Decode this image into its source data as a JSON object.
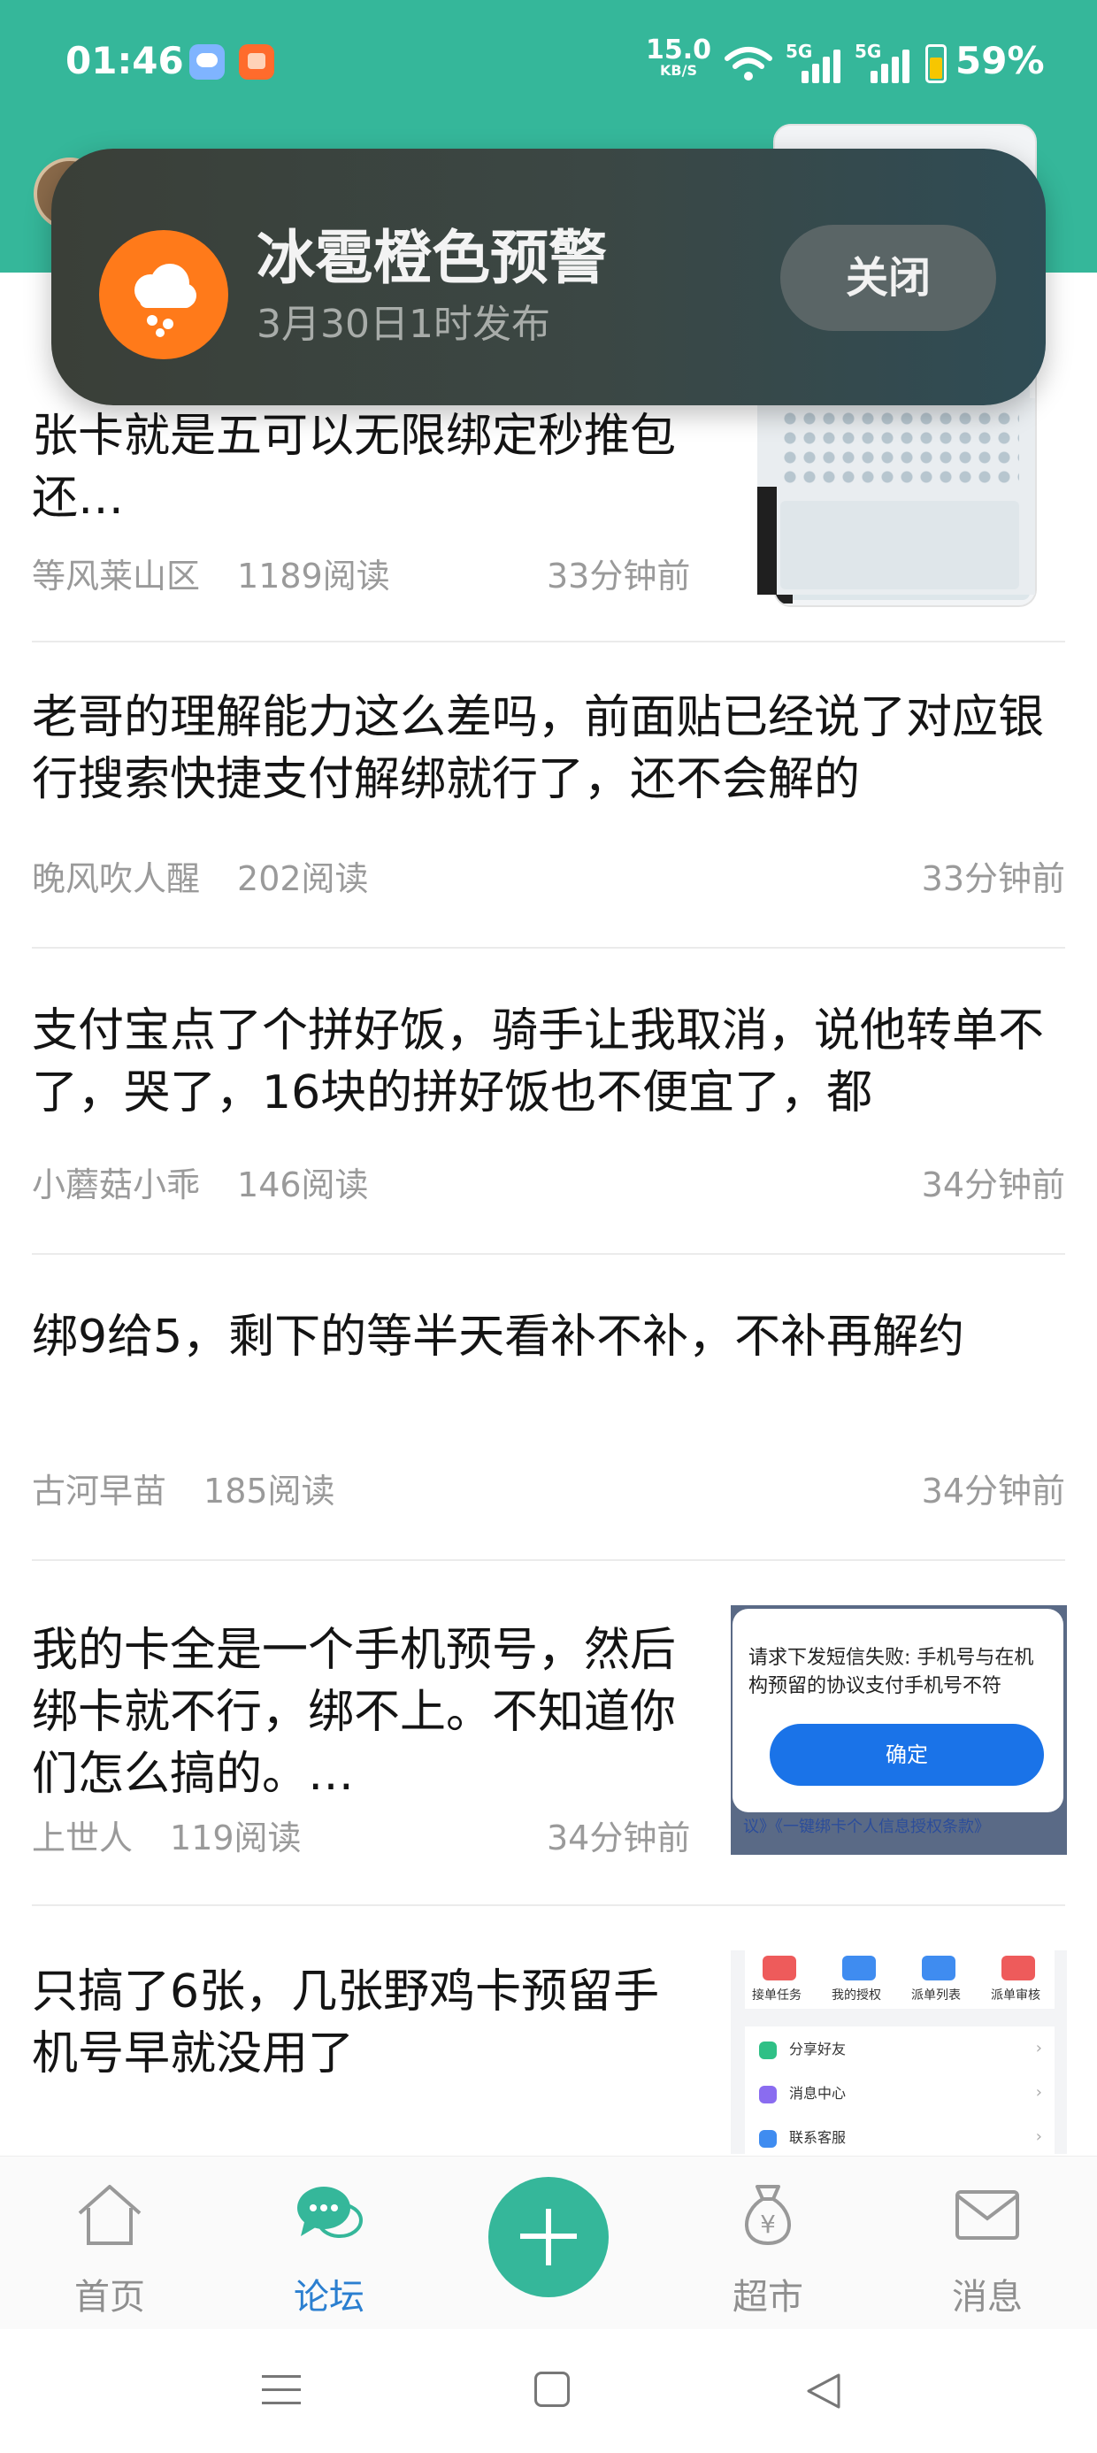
{
  "status_bar": {
    "time": "01:46",
    "net_speed": "15.0",
    "net_unit": "KB/S",
    "signal1": "5G",
    "signal2": "5G",
    "battery": "59%"
  },
  "alert": {
    "title": "冰雹橙色预警",
    "subtitle": "3月30日1时发布",
    "close_label": "关闭",
    "icon": "hail-cloud-icon",
    "color": "#ff7a1a"
  },
  "posts": [
    {
      "title": "张卡就是五可以无限绑定秒推包还…",
      "author": "等风莱山区",
      "reads": "1189阅读",
      "time": "33分钟前",
      "has_thumb": true
    },
    {
      "title": "老哥的理解能力这么差吗，前面贴已经说了对应银行搜索快捷支付解绑就行了，还不会解的",
      "author": "晚风吹人醒",
      "reads": "202阅读",
      "time": "33分钟前",
      "has_thumb": false
    },
    {
      "title": "支付宝点了个拼好饭，骑手让我取消，说他转单不了，哭了，16块的拼好饭也不便宜了，都",
      "author": "小蘑菇小乖",
      "reads": "146阅读",
      "time": "34分钟前",
      "has_thumb": false
    },
    {
      "title": "绑9给5，剩下的等半天看补不补，不补再解约",
      "author": "古河早苗",
      "reads": "185阅读",
      "time": "34分钟前",
      "has_thumb": false
    },
    {
      "title": "我的卡全是一个手机预号，然后绑卡就不行，绑不上。不知道你们怎么搞的。…",
      "author": "上世人",
      "reads": "119阅读",
      "time": "34分钟前",
      "has_thumb": true
    },
    {
      "title": "只搞了6张，几张野鸡卡预留手机号早就没用了",
      "author": "",
      "reads": "",
      "time": "",
      "has_thumb": true
    }
  ],
  "thumb_dialog": {
    "text": "请求下发短信失败: 手机号与在机构预留的协议支付手机号不符",
    "button": "确定",
    "footer": "议》《一键绑卡个人信息授权条款》"
  },
  "thumb_menu": {
    "top_items": [
      "接单任务",
      "我的授权",
      "派单列表",
      "派单审核"
    ],
    "list_items": [
      "分享好友",
      "消息中心",
      "联系客服"
    ]
  },
  "tabbar": {
    "home": "首页",
    "forum": "论坛",
    "market": "超市",
    "messages": "消息",
    "active": "forum",
    "accent": "#35b79a",
    "active_color": "#2b7fd0"
  }
}
